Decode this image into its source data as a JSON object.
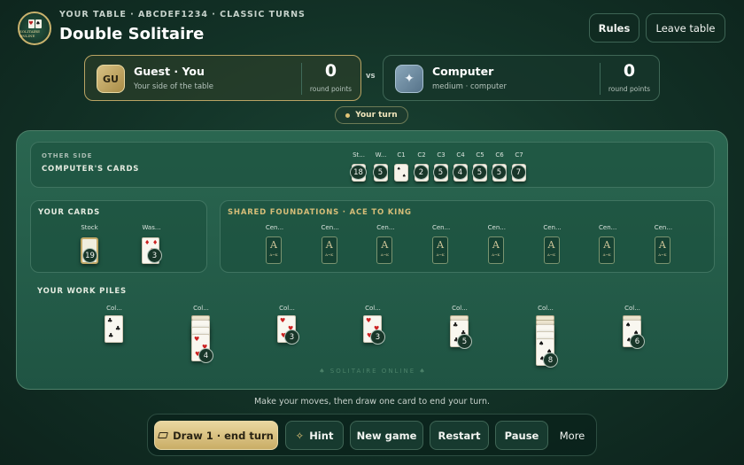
{
  "header": {
    "logo_text": "SOLITAIRE ONLINE",
    "subtitle": "YOUR TABLE · ABCDEF1234 · CLASSIC TURNS",
    "title": "Double Solitaire",
    "rules_label": "Rules",
    "leave_label": "Leave table"
  },
  "players": {
    "you": {
      "initials": "GU",
      "name": "Guest · You",
      "sub": "Your side of the table",
      "score": "0",
      "score_label": "round points"
    },
    "vs": "vs",
    "cpu": {
      "icon": "sparkle-icon",
      "name": "Computer",
      "sub": "medium · computer",
      "score": "0",
      "score_label": "round points"
    }
  },
  "turn_label": "Your turn",
  "other_side": {
    "kicker": "OTHER SIDE",
    "title": "COMPUTER'S CARDS",
    "piles": [
      {
        "label": "St...",
        "count": "18"
      },
      {
        "label": "W...",
        "count": "5"
      },
      {
        "label": "C1",
        "count": ""
      },
      {
        "label": "C2",
        "count": "2"
      },
      {
        "label": "C3",
        "count": "5"
      },
      {
        "label": "C4",
        "count": "4"
      },
      {
        "label": "C5",
        "count": "5"
      },
      {
        "label": "C6",
        "count": "5"
      },
      {
        "label": "C7",
        "count": "7"
      }
    ]
  },
  "your_cards": {
    "title": "YOUR CARDS",
    "stock_label": "Stock",
    "stock_count": "19",
    "waste_label": "Was...",
    "waste_count": "3"
  },
  "foundations": {
    "title": "SHARED FOUNDATIONS · ACE TO KING",
    "slot_label": "Cen...",
    "slot_letter": "A",
    "slot_range": "A→K",
    "count": 8
  },
  "work_piles": {
    "title": "YOUR WORK PILES",
    "col_label": "Col...",
    "counts": [
      "",
      "4",
      "3",
      "3",
      "5",
      "8",
      "6"
    ]
  },
  "watermark": "♠ SOLITAIRE ONLINE ♠",
  "footer_text": "Make your moves, then draw one card to end your turn.",
  "actions": {
    "draw": "Draw 1 · end turn",
    "hint": "Hint",
    "new_game": "New game",
    "restart": "Restart",
    "pause": "Pause",
    "more": "More"
  },
  "colors": {
    "gold": "#d5bd78",
    "felt": "#2a6650",
    "background": "#123126"
  }
}
